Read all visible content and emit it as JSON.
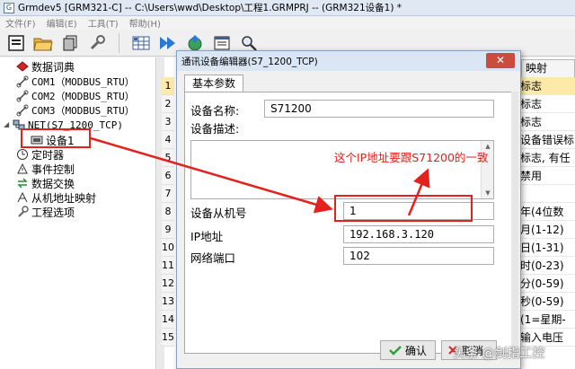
{
  "window": {
    "title": "Grmdev5 [GRM321-C]  -- C:\\Users\\wwd\\Desktop\\工程1.GRMPRJ -- (GRM321设备1) *"
  },
  "menu": [
    "文件(F)",
    "编辑(E)",
    "工具(T)",
    "帮助(H)"
  ],
  "toolbar_icons": [
    "new-project-icon",
    "open-folder-icon",
    "copy-icon",
    "wrench-icon",
    "grid-icon",
    "play-double-icon",
    "globe-upload-icon",
    "window-icon",
    "search-icon"
  ],
  "tree": {
    "items": [
      {
        "label": "数据词典",
        "icon": "book-icon"
      },
      {
        "label": "COM1（MODBUS_RTU）",
        "icon": "link-icon"
      },
      {
        "label": "COM2（MODBUS_RTU）",
        "icon": "link-icon"
      },
      {
        "label": "COM3（MODBUS_RTU）",
        "icon": "link-icon"
      },
      {
        "label": "NET(S7_1200_TCP)",
        "icon": "network-icon"
      },
      {
        "label": "设备1",
        "icon": "device-icon"
      },
      {
        "label": "定时器",
        "icon": "timer-icon"
      },
      {
        "label": "事件控制",
        "icon": "event-icon"
      },
      {
        "label": "数据交换",
        "icon": "exchange-icon"
      },
      {
        "label": "从机地址映射",
        "icon": "mapping-icon"
      },
      {
        "label": "工程选项",
        "icon": "wrench-icon"
      }
    ]
  },
  "background": {
    "tab_label": "映射",
    "col_header": "ID",
    "row_numbers": [
      "1",
      "2",
      "3",
      "4",
      "5",
      "6",
      "7",
      "8",
      "9",
      "10",
      "11",
      "12",
      "13",
      "14",
      "15"
    ],
    "right_cells": [
      "标志",
      "标志",
      "标志",
      "设备错误标",
      "标志, 有任",
      "禁用",
      "",
      "年(4位数",
      "月(1-12)",
      "日(1-31)",
      "时(0-23)",
      "分(0-59)",
      "秒(0-59)",
      "(1=星期-",
      "输入电压"
    ]
  },
  "dialog": {
    "title": "通讯设备编辑器(S7_1200_TCP)",
    "close_label": "✕",
    "tab": "基本参数",
    "fields": {
      "name_label": "设备名称:",
      "name_value": "S71200",
      "desc_label": "设备描述:",
      "slave_label": "设备从机号",
      "slave_value": "1",
      "ip_label": "IP地址",
      "ip_value": "192.168.3.120",
      "port_label": "网络端口",
      "port_value": "102"
    },
    "ok_label": "确认",
    "cancel_label": "取消"
  },
  "annotation": {
    "text": "这个IP地址要跟S71200的一致",
    "color": "#e3221e"
  },
  "watermark": "头条 @剑指工控"
}
